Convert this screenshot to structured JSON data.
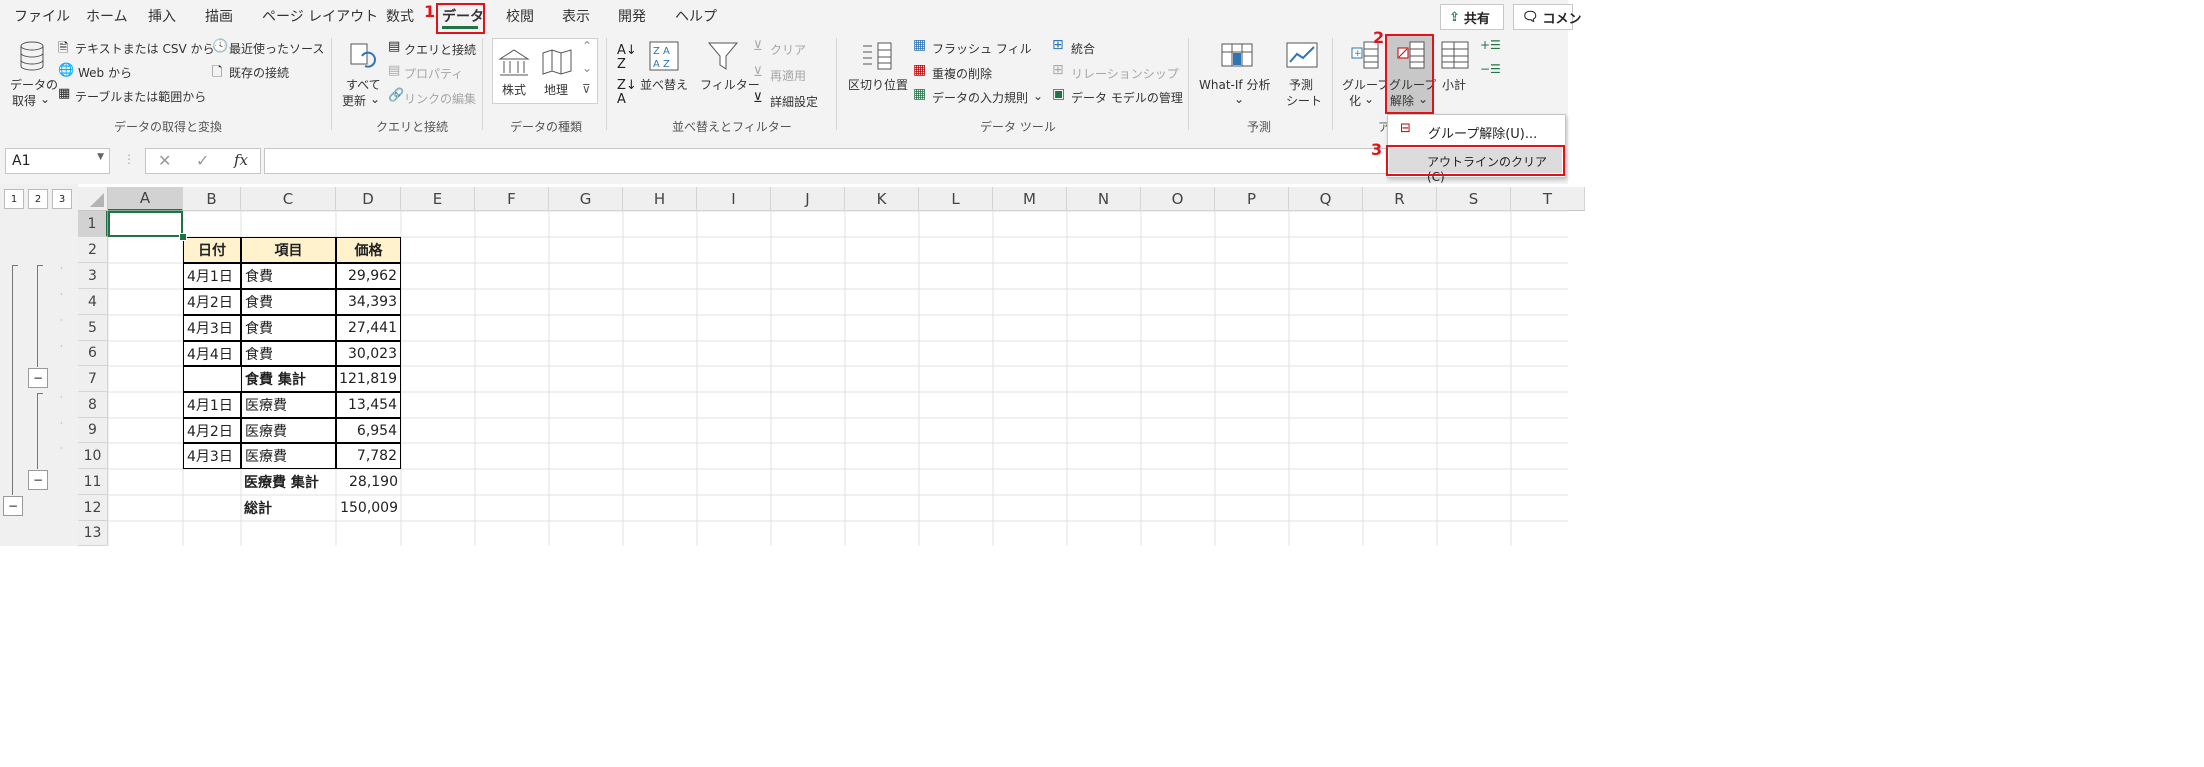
{
  "tabs": [
    "ファイル",
    "ホーム",
    "挿入",
    "描画",
    "ページ レイアウト",
    "数式",
    "データ",
    "校閲",
    "表示",
    "開発",
    "ヘルプ"
  ],
  "top_right": {
    "share": "共有",
    "comment": "コメン"
  },
  "steps": [
    "1",
    "2",
    "3"
  ],
  "ribbon": {
    "get_data": [
      "データの",
      "取得"
    ],
    "text_csv": "テキストまたは CSV から",
    "web": "Web から",
    "table_range": "テーブルまたは範囲から",
    "recent": "最近使ったソース",
    "existing": "既存の接続",
    "group1": "データの取得と変換",
    "refresh_all": [
      "すべて",
      "更新"
    ],
    "queries": "クエリと接続",
    "properties": "プロパティ",
    "edit_links": "リンクの編集",
    "group2": "クエリと接続",
    "stocks": "株式",
    "geography": "地理",
    "group3": "データの種類",
    "sort": "並べ替え",
    "filter": "フィルター",
    "clear": "クリア",
    "reapply": "再適用",
    "advanced": "詳細設定",
    "group4": "並べ替えとフィルター",
    "text_to_col": "区切り位置",
    "flash_fill": "フラッシュ フィル",
    "remove_dup": "重複の削除",
    "validation": "データの入力規則",
    "consolidate": "統合",
    "relationships": "リレーションシップ",
    "data_model": "データ モデルの管理",
    "group5": "データ ツール",
    "what_if": "What-If 分析",
    "forecast": [
      "予測",
      "シート"
    ],
    "group6": "予測",
    "group_btn": [
      "グループ",
      "化"
    ],
    "ungroup_btn": [
      "グループ",
      "解除"
    ],
    "subtotal": "小計",
    "group7": "ア"
  },
  "dropdown": {
    "ungroup": "グループ解除(U)...",
    "clear_outline": "アウトラインのクリア(C)"
  },
  "formula": {
    "name_box": "A1",
    "fx": "fx",
    "value": ""
  },
  "outline_levels": [
    "1",
    "2",
    "3"
  ],
  "collapse_symbol": "−",
  "columns": [
    "A",
    "B",
    "C",
    "D",
    "E",
    "F",
    "G",
    "H",
    "I",
    "J",
    "K",
    "L",
    "M",
    "N",
    "O",
    "P",
    "Q",
    "R",
    "S",
    "T"
  ],
  "rows": [
    "1",
    "2",
    "3",
    "4",
    "5",
    "6",
    "7",
    "8",
    "9",
    "10",
    "11",
    "12",
    "13"
  ],
  "table": {
    "headers": [
      "日付",
      "項目",
      "価格"
    ],
    "rows": [
      [
        "4月1日",
        "食費",
        "29,962"
      ],
      [
        "4月2日",
        "食費",
        "34,393"
      ],
      [
        "4月3日",
        "食費",
        "27,441"
      ],
      [
        "4月4日",
        "食費",
        "30,023"
      ],
      [
        "",
        "食費 集計",
        "121,819"
      ],
      [
        "4月1日",
        "医療費",
        "13,454"
      ],
      [
        "4月2日",
        "医療費",
        "6,954"
      ],
      [
        "4月3日",
        "医療費",
        "7,782"
      ],
      [
        "",
        "医療費 集計",
        "28,190"
      ],
      [
        "",
        "総計",
        "150,009"
      ]
    ]
  },
  "colors": {
    "accent": "#217346",
    "step_red": "#e0131a",
    "header_fill": "#fff2cc"
  }
}
